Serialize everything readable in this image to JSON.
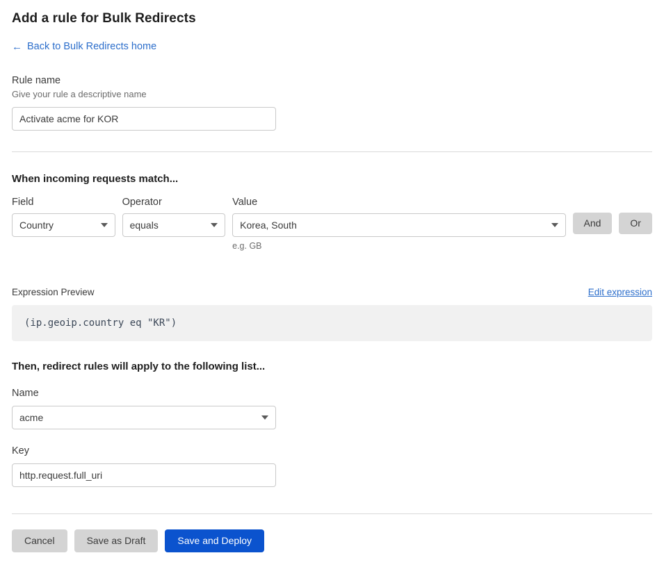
{
  "header": {
    "title": "Add a rule for Bulk Redirects",
    "back_link": "Back to Bulk Redirects home",
    "back_arrow_icon": "←"
  },
  "rule_name": {
    "label": "Rule name",
    "help": "Give your rule a descriptive name",
    "value": "Activate acme for KOR"
  },
  "match": {
    "section_title": "When incoming requests match...",
    "field": {
      "label": "Field",
      "value": "Country"
    },
    "operator": {
      "label": "Operator",
      "value": "equals"
    },
    "value": {
      "label": "Value",
      "value": "Korea, South",
      "hint": "e.g. GB"
    },
    "and_label": "And",
    "or_label": "Or"
  },
  "expression": {
    "label": "Expression Preview",
    "edit_label": "Edit expression",
    "preview": "(ip.geoip.country eq \"KR\")"
  },
  "list": {
    "section_title": "Then, redirect rules will apply to the following list...",
    "name": {
      "label": "Name",
      "value": "acme"
    },
    "key": {
      "label": "Key",
      "value": "http.request.full_uri"
    }
  },
  "footer": {
    "cancel_label": "Cancel",
    "draft_label": "Save as Draft",
    "deploy_label": "Save and Deploy"
  },
  "colors": {
    "link": "#2c6ecb",
    "primary": "#0b53ce",
    "grey_button": "#d4d4d4",
    "code_background": "#f1f1f1",
    "divider": "#d9d9d9"
  }
}
